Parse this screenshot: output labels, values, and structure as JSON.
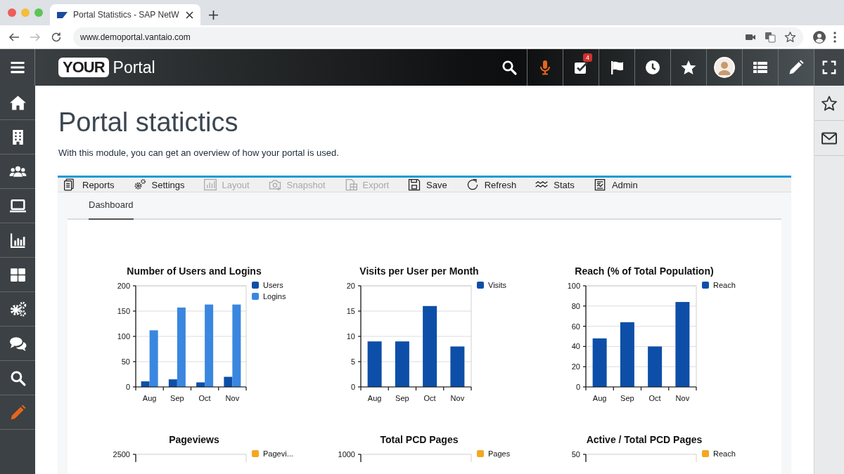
{
  "browser": {
    "tab_title": "Portal Statistics - SAP NetW",
    "url": "www.demoportal.vantaio.com"
  },
  "header": {
    "logo_badge": "YOUR",
    "logo_text": "Portal",
    "buttons": [
      {
        "active": false
      },
      {
        "active": true
      },
      {
        "active": false,
        "badge": "4"
      },
      {
        "active": false
      },
      {
        "active": false
      },
      {
        "active": false
      },
      {
        "active": false
      },
      {
        "active": false
      },
      {
        "active": false
      }
    ]
  },
  "sidebar": {
    "items": [
      {
        "selected": false
      },
      {
        "selected": false
      },
      {
        "selected": false
      },
      {
        "selected": false
      },
      {
        "selected": false
      },
      {
        "selected": false
      },
      {
        "selected": false
      },
      {
        "selected": false
      },
      {
        "selected": false
      },
      {
        "selected": true
      }
    ]
  },
  "page": {
    "title": "Portal statictics",
    "subtitle": "With this module, you can get an overview of how your portal is used."
  },
  "toolbar": [
    {
      "label": "Reports",
      "disabled": false
    },
    {
      "label": "Settings",
      "disabled": false
    },
    {
      "label": "Layout",
      "disabled": true
    },
    {
      "label": "Snapshot",
      "disabled": true
    },
    {
      "label": "Export",
      "disabled": true
    },
    {
      "label": "Save",
      "disabled": false
    },
    {
      "label": "Refresh",
      "disabled": false
    },
    {
      "label": "Stats",
      "disabled": false
    },
    {
      "label": "Admin",
      "disabled": false
    }
  ],
  "tabs": [
    {
      "label": "Dashboard",
      "selected": true
    }
  ],
  "charts": [
    {
      "chart_data": {
        "type": "bar",
        "title": "Number of Users and Logins",
        "grid": true,
        "legend": "right",
        "categories": [
          "Aug",
          "Sep",
          "Oct",
          "Nov"
        ],
        "ylim": [
          0,
          200
        ],
        "yticks": [
          0,
          50,
          100,
          150,
          200
        ],
        "series": [
          {
            "name": "Users",
            "color": "#0d4fa8",
            "values": [
              11,
              15,
              9,
              20
            ]
          },
          {
            "name": "Logins",
            "color": "#3a87e0",
            "values": [
              112,
              157,
              163,
              163
            ]
          }
        ]
      }
    },
    {
      "chart_data": {
        "type": "bar",
        "title": "Visits per User per Month",
        "grid": true,
        "legend": "right",
        "categories": [
          "Aug",
          "Sep",
          "Oct",
          "Nov"
        ],
        "ylim": [
          0,
          20
        ],
        "yticks": [
          0,
          5,
          10,
          15,
          20
        ],
        "series": [
          {
            "name": "Visits",
            "color": "#0d4fa8",
            "values": [
              9,
              9,
              16,
              8
            ]
          }
        ]
      }
    },
    {
      "chart_data": {
        "type": "bar",
        "title": "Reach (% of Total Population)",
        "grid": true,
        "legend": "right",
        "categories": [
          "Aug",
          "Sep",
          "Oct",
          "Nov"
        ],
        "ylim": [
          0,
          100
        ],
        "yticks": [
          0,
          20,
          40,
          60,
          80,
          100
        ],
        "series": [
          {
            "name": "Reach",
            "color": "#0d4fa8",
            "values": [
              48,
              64,
              40,
              84
            ]
          }
        ]
      }
    },
    {
      "title": "Pageviews",
      "axis_label": "2500",
      "legend": [
        {
          "name": "Pagevi...",
          "color": "#f5a623"
        }
      ]
    },
    {
      "title": "Total PCD Pages",
      "axis_label": "1000",
      "legend": [
        {
          "name": "Pages",
          "color": "#f5a623"
        }
      ]
    },
    {
      "title": "Active / Total PCD Pages",
      "axis_label": "50",
      "legend": [
        {
          "name": "Reach",
          "color": "#f5a623"
        }
      ]
    }
  ]
}
